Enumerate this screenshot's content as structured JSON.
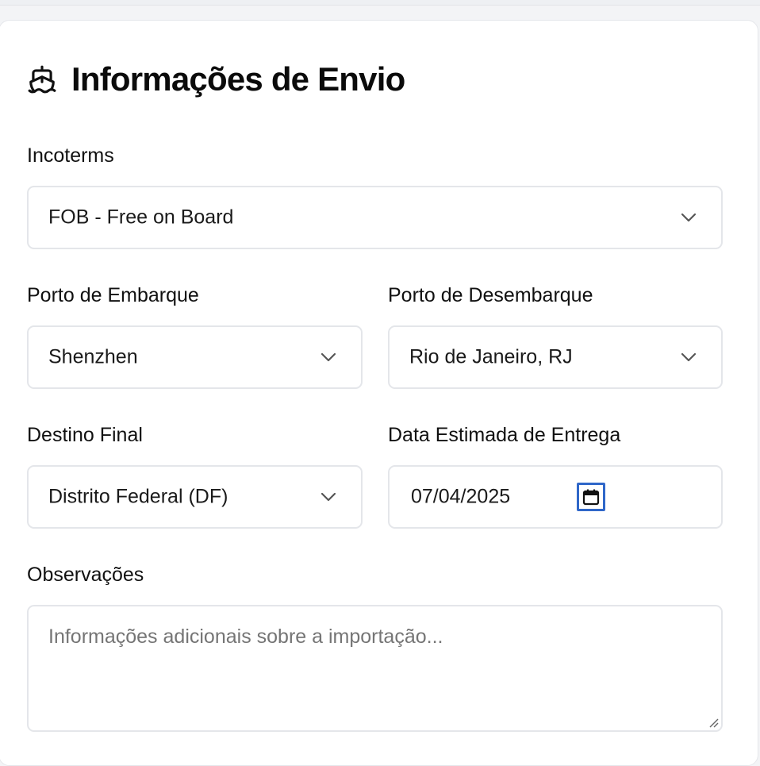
{
  "section": {
    "title": "Informações de Envio",
    "icon": "ship-icon"
  },
  "incoterms": {
    "label": "Incoterms",
    "value": "FOB - Free on Board"
  },
  "porto_embarque": {
    "label": "Porto de Embarque",
    "value": "Shenzhen"
  },
  "porto_desembarque": {
    "label": "Porto de Desembarque",
    "value": "Rio de Janeiro, RJ"
  },
  "destino_final": {
    "label": "Destino Final",
    "value": "Distrito Federal (DF)"
  },
  "data_entrega": {
    "label": "Data Estimada de Entrega",
    "value": "07/04/2025",
    "icon": "calendar-icon"
  },
  "observacoes": {
    "label": "Observações",
    "placeholder": "Informações adicionais sobre a importação..."
  },
  "colors": {
    "focus_ring": "#2f67c9",
    "border": "#e4e6ea",
    "placeholder": "#757575",
    "text": "#111111"
  }
}
